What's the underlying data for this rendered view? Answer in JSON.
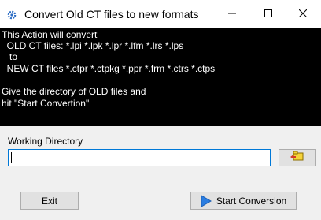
{
  "window": {
    "title": "Convert Old CT files to new formats",
    "app_icon": "gear-icon",
    "controls": {
      "minimize": "minimize-icon",
      "maximize": "maximize-icon",
      "close": "close-icon"
    }
  },
  "info": {
    "lines": [
      "This Action will convert",
      "  OLD CT files: *.lpi *.lpk *.lpr *.lfm *.lrs *.lps",
      "   to",
      "  NEW CT files *.ctpr *.ctpkg *.ppr *.frm *.ctrs *.ctps",
      "",
      "Give the directory of OLD files and",
      "hit \"Start Convertion\""
    ]
  },
  "form": {
    "working_directory_label": "Working Directory",
    "working_directory_value": "",
    "browse_icon": "folder-browse-icon"
  },
  "buttons": {
    "exit_label": "Exit",
    "start_label": "Start Conversion",
    "start_icon": "play-icon"
  },
  "colors": {
    "panel_bg": "#000000",
    "panel_fg": "#ffffff",
    "accent": "#0078d7"
  }
}
